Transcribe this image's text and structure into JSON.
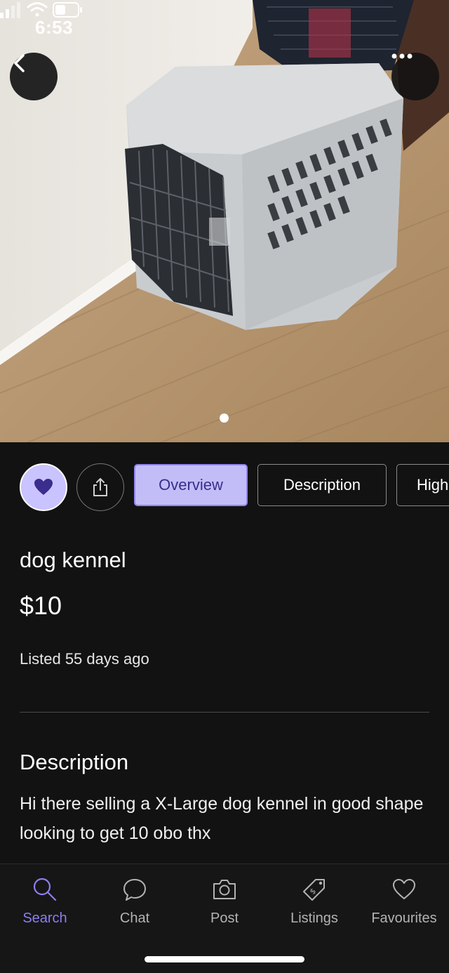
{
  "status_bar": {
    "time": "6:53"
  },
  "photo": {
    "alt": "dog kennel photo",
    "page_indicator": {
      "current": 1,
      "total": 1
    }
  },
  "actions": {
    "favourite_icon": "heart-icon",
    "share_icon": "share-icon",
    "tabs": [
      {
        "label": "Overview",
        "selected": true
      },
      {
        "label": "Description",
        "selected": false
      },
      {
        "label": "High",
        "selected": false
      }
    ]
  },
  "listing": {
    "title": "dog kennel",
    "price": "$10",
    "listed": "Listed 55 days ago",
    "description_heading": "Description",
    "description_body": "Hi there selling a X-Large dog kennel in good shape looking to get 10 obo thx"
  },
  "tabbar": {
    "items": [
      {
        "label": "Search",
        "icon": "search-icon",
        "active": true
      },
      {
        "label": "Chat",
        "icon": "chat-bubble-icon",
        "active": false
      },
      {
        "label": "Post",
        "icon": "camera-icon",
        "active": false
      },
      {
        "label": "Listings",
        "icon": "price-tag-icon",
        "active": false
      },
      {
        "label": "Favourites",
        "icon": "heart-icon",
        "active": false
      }
    ]
  },
  "colors": {
    "accent": "#8b7ff0",
    "chip_selected_bg": "#c3bdf7",
    "background": "#121212"
  }
}
